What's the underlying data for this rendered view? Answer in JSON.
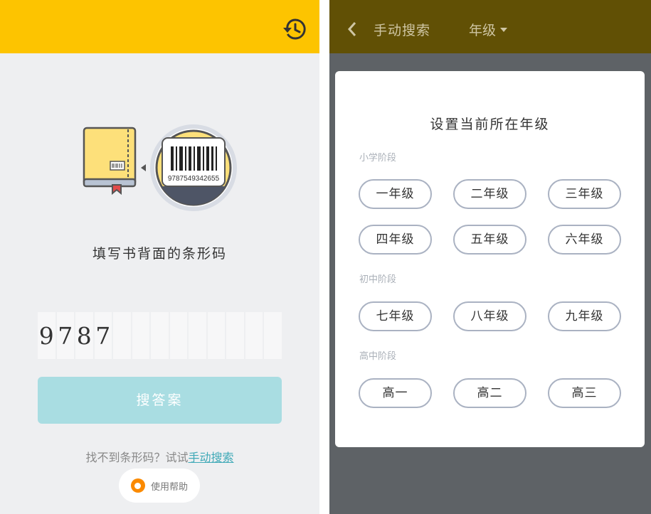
{
  "left": {
    "history_icon": "history-icon",
    "illustration": {
      "barcode_number": "9787549342655"
    },
    "prompt": "填写书背面的条形码",
    "digits": [
      "9",
      "7",
      "8",
      "7",
      "",
      "",
      "",
      "",
      "",
      "",
      "",
      "",
      ""
    ],
    "search_button": "搜答案",
    "hint_prefix": "找不到条形码？试试",
    "hint_link": "手动搜索",
    "help_label": "使用帮助"
  },
  "right": {
    "back_icon": "chevron-left-icon",
    "nav_title": "手动搜索",
    "grade_dropdown": "年级",
    "dialog": {
      "title": "设置当前所在年级",
      "sections": [
        {
          "label": "小学阶段",
          "grades": [
            "一年级",
            "二年级",
            "三年级",
            "四年级",
            "五年级",
            "六年级"
          ]
        },
        {
          "label": "初中阶段",
          "grades": [
            "七年级",
            "八年级",
            "九年级"
          ]
        },
        {
          "label": "高中阶段",
          "grades": [
            "高一",
            "高二",
            "高三"
          ]
        }
      ]
    }
  },
  "colors": {
    "left_header": "#fdc400",
    "right_header": "#615005",
    "search_button": "#a9dde2",
    "link": "#3fa9b7",
    "help_dot": "#fb8a00"
  }
}
